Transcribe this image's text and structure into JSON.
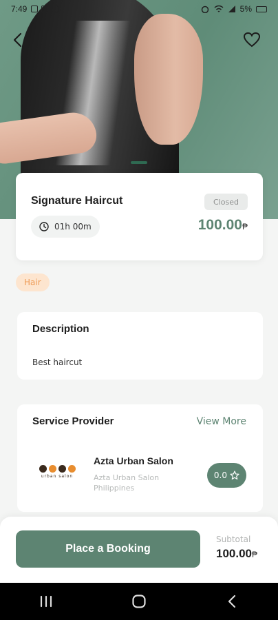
{
  "status_bar": {
    "time": "7:49",
    "battery": "5%"
  },
  "service": {
    "title": "Signature Haircut",
    "status_badge": "Closed",
    "duration": "01h 00m",
    "price": "100.00",
    "currency_symbol": "₱",
    "category_tag": "Hair"
  },
  "description": {
    "heading": "Description",
    "text": "Best haircut"
  },
  "provider": {
    "heading": "Service Provider",
    "view_more": "View More",
    "name": "Azta Urban Salon",
    "address": "Azta Urban Salon Philippines",
    "rating": "0.0",
    "logo_text": "urban salon"
  },
  "booking": {
    "button_label": "Place a Booking",
    "subtotal_label": "Subtotal",
    "subtotal_value": "100.00"
  },
  "colors": {
    "accent": "#5d8472",
    "tag_bg": "#fde5cf",
    "tag_text": "#ee9b56"
  }
}
